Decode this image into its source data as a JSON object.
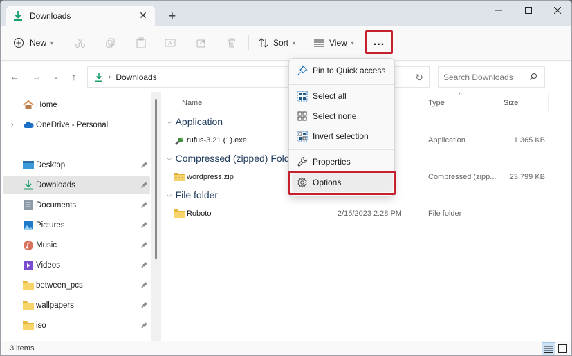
{
  "window": {
    "tab_title": "Downloads",
    "tab_icon": "download-icon",
    "new_tab_icon": "plus-icon",
    "controls": [
      "minimize-icon",
      "maximize-icon",
      "close-icon"
    ]
  },
  "toolbar": {
    "new_label": "New",
    "sort_label": "Sort",
    "view_label": "View",
    "more_label": "...",
    "disabled_icons": [
      "cut-icon",
      "copy-icon",
      "paste-icon",
      "rename-icon",
      "share-icon",
      "delete-icon"
    ],
    "highlight_color": "#c4202d"
  },
  "address": {
    "breadcrumb": [
      "Downloads"
    ],
    "search_placeholder": "Search Downloads"
  },
  "sidebar": {
    "items": [
      {
        "label": "Home",
        "icon": "home-icon",
        "pinned": false,
        "expandable": false
      },
      {
        "label": "OneDrive - Personal",
        "icon": "cloud-icon",
        "pinned": false,
        "expandable": true
      },
      {
        "label": "Desktop",
        "icon": "desktop-icon",
        "pinned": true
      },
      {
        "label": "Downloads",
        "icon": "download-icon",
        "pinned": true,
        "selected": true
      },
      {
        "label": "Documents",
        "icon": "documents-icon",
        "pinned": true
      },
      {
        "label": "Pictures",
        "icon": "pictures-icon",
        "pinned": true
      },
      {
        "label": "Music",
        "icon": "music-icon",
        "pinned": true
      },
      {
        "label": "Videos",
        "icon": "videos-icon",
        "pinned": true
      },
      {
        "label": "between_pcs",
        "icon": "folder-icon",
        "pinned": true
      },
      {
        "label": "wallpapers",
        "icon": "folder-icon",
        "pinned": true
      },
      {
        "label": "iso",
        "icon": "folder-icon",
        "pinned": true
      }
    ]
  },
  "columns": {
    "name": "Name",
    "type": "Type",
    "size": "Size"
  },
  "groups": [
    {
      "label": "Application",
      "files": [
        {
          "name": "rufus-3.21 (1).exe",
          "date": "",
          "type": "Application",
          "size": "1,365 KB",
          "icon": "exe-icon"
        }
      ]
    },
    {
      "label": "Compressed (zipped) Folder",
      "files": [
        {
          "name": "wordpress.zip",
          "date": "",
          "type": "Compressed (zipp...",
          "size": "23,799 KB",
          "icon": "zip-icon"
        }
      ]
    },
    {
      "label": "File folder",
      "files": [
        {
          "name": "Roboto",
          "date": "2/15/2023 2:28 PM",
          "type": "File folder",
          "size": "",
          "icon": "folder-icon"
        }
      ]
    }
  ],
  "menu": {
    "items": [
      {
        "label": "Pin to Quick access",
        "icon": "pin-icon"
      },
      {
        "label": "Select all",
        "icon": "select-all-icon"
      },
      {
        "label": "Select none",
        "icon": "select-none-icon"
      },
      {
        "label": "Invert selection",
        "icon": "invert-selection-icon"
      },
      {
        "label": "Properties",
        "icon": "wrench-icon"
      },
      {
        "label": "Options",
        "icon": "gear-icon",
        "highlighted": true
      }
    ]
  },
  "status": {
    "item_count": "3 items"
  }
}
